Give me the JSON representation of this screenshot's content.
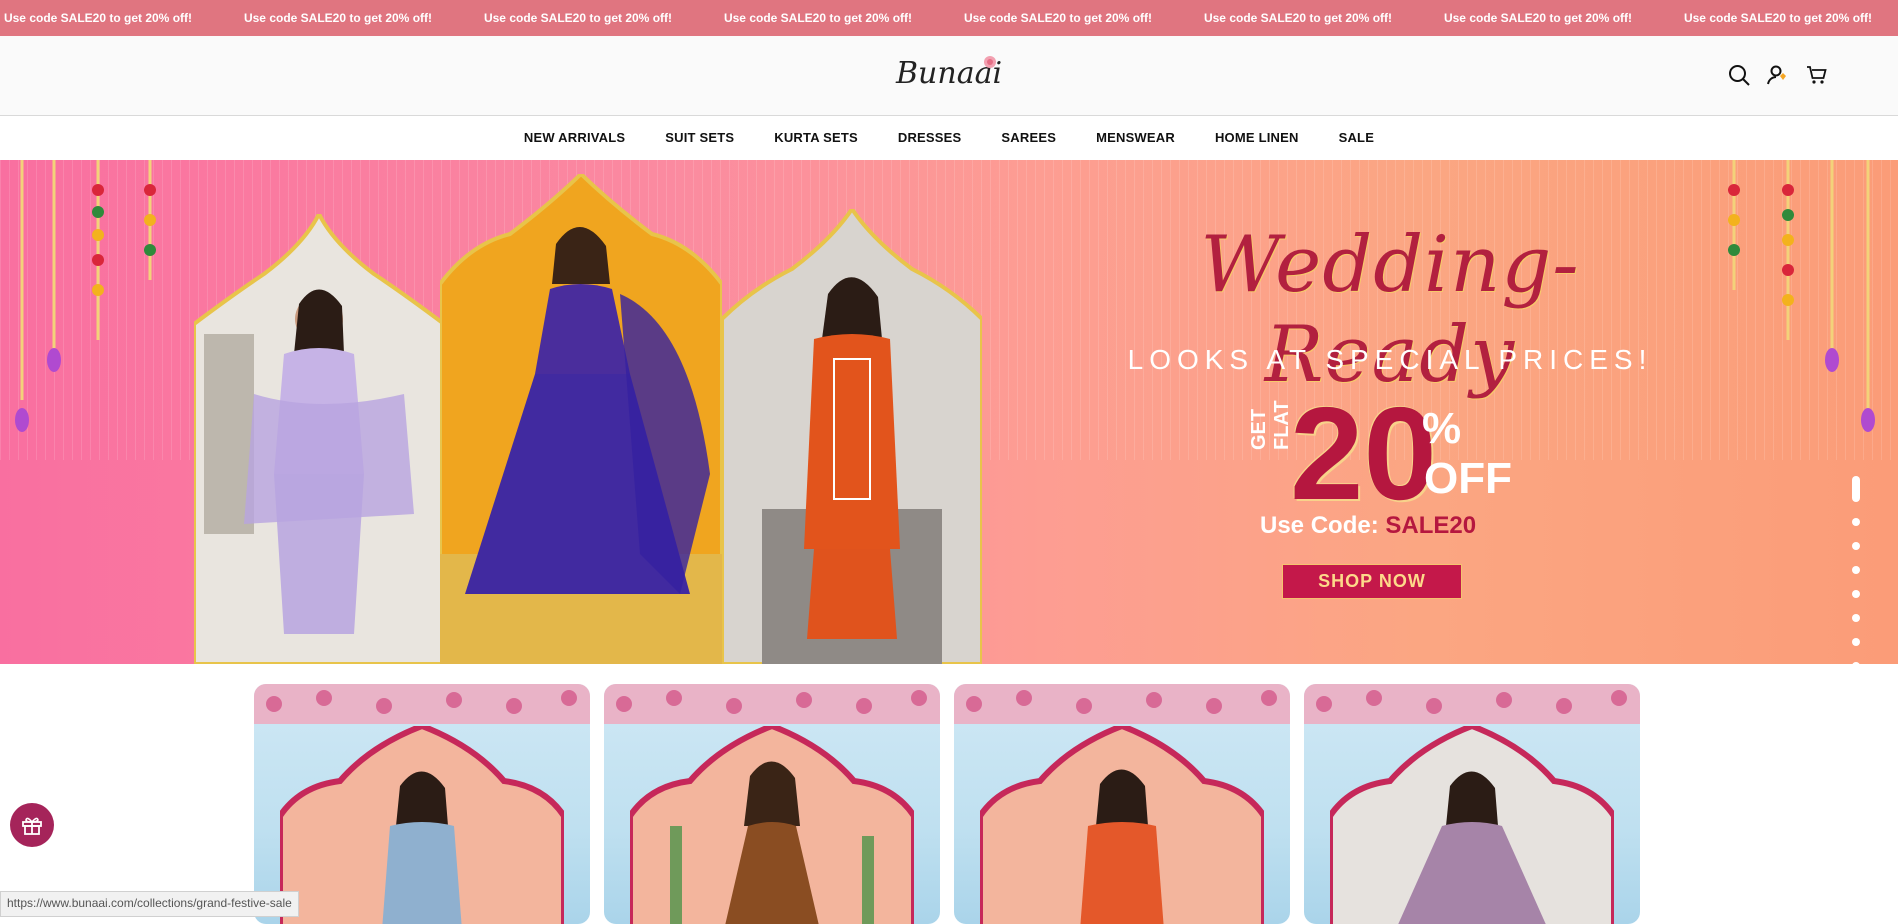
{
  "announcement": {
    "items": [
      "Use code SALE20 to get 20% off!",
      "Use code SALE20 to get 20% off!",
      "Use code SALE20 to get 20% off!",
      "Use code SALE20 to get 20% off!",
      "Use code SALE20 to get 20% off!",
      "Use code SALE20 to get 20% off!",
      "Use code SALE20 to get 20% off!",
      "Use code SALE20 to get 20% off!"
    ]
  },
  "header": {
    "logo_text": "Bunaai",
    "icons": [
      "search-icon",
      "account-icon",
      "cart-icon"
    ]
  },
  "nav": {
    "items": [
      "NEW ARRIVALS",
      "SUIT SETS",
      "KURTA SETS",
      "DRESSES",
      "SAREES",
      "MENSWEAR",
      "HOME LINEN",
      "SALE"
    ]
  },
  "hero": {
    "title": "Wedding-Ready",
    "subtitle": "LOOKS AT SPECIAL PRICES!",
    "get_flat": "GET FLAT",
    "discount": "20",
    "percent": "%",
    "off": "OFF",
    "code_label": "Use Code: ",
    "code": "SALE20",
    "cta": "SHOP NOW",
    "slide_count": 9,
    "active_slide": 1
  },
  "status_bar": {
    "url": "https://www.bunaai.com/collections/grand-festive-sale"
  },
  "colors": {
    "announcement_bg": "#e07580",
    "brand_accent": "#b5173f",
    "gift_button": "#a5245a"
  }
}
